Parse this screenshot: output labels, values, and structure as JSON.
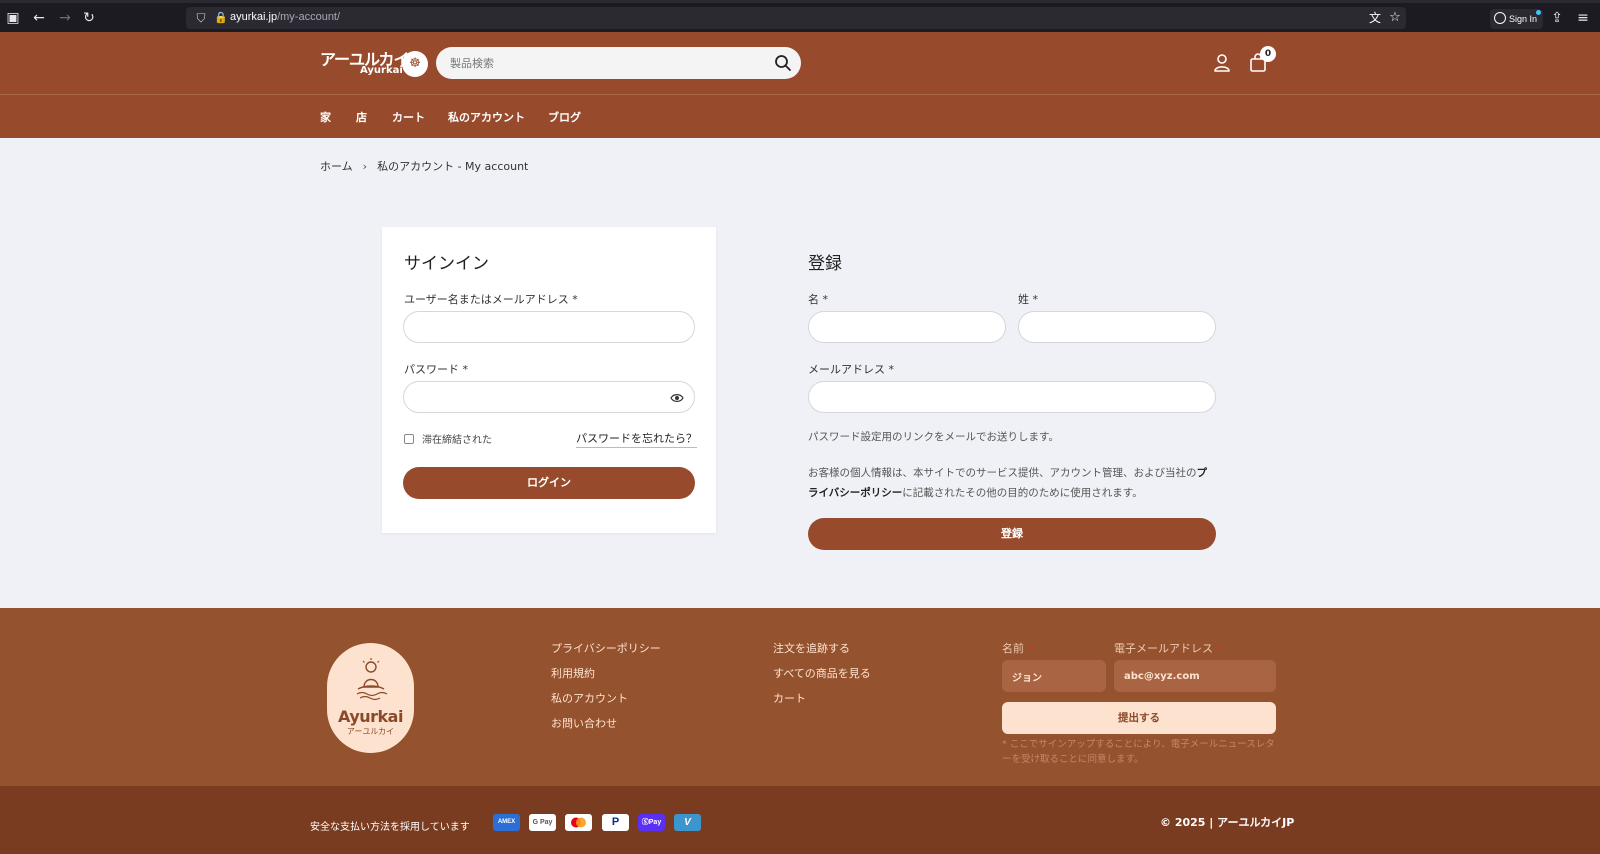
{
  "browser": {
    "url_host": "ayurkai.jp",
    "url_path": "/my-account/",
    "signin_label": "Sign In"
  },
  "header": {
    "logo_jp": "アーユルカイ",
    "logo_en": "Ayurkai",
    "search_placeholder": "製品検索",
    "cart_count": "0"
  },
  "nav": {
    "items": [
      "家",
      "店",
      "カート",
      "私のアカウント",
      "ブログ"
    ]
  },
  "breadcrumb": {
    "home": "ホーム",
    "sep": "›",
    "current": "私のアカウント - My account"
  },
  "signin": {
    "title": "サインイン",
    "username_label": "ユーザー名またはメールアドレス *",
    "password_label": "パスワード *",
    "remember_label": "滞在締結された",
    "forgot_label": "パスワードを忘れたら？",
    "login_button": "ログイン"
  },
  "register": {
    "title": "登録",
    "first_name_label": "名 *",
    "last_name_label": "姓 *",
    "email_label": "メールアドレス *",
    "password_note": "パスワード設定用のリンクをメールでお送りします。",
    "privacy_note_1": "お客様の個人情報は、本サイトでのサービス提供、アカウント管理、および当社の",
    "privacy_link_1": "プ",
    "privacy_link_2": "ライバシーポリシー",
    "privacy_note_2": "に記載されたその他の目的のために使用されます。",
    "register_button": "登録"
  },
  "footer": {
    "logo_en": "Ayurkai",
    "logo_jp": "アーユルカイ",
    "col1": [
      "プライバシーポリシー",
      "利用規約",
      "私のアカウント",
      "お問い合わせ"
    ],
    "col2": [
      "注文を追跡する",
      "すべての商品を見る",
      "カート"
    ],
    "name_label": "名前",
    "email_label": "電子メールアドレス",
    "required_mark": "*",
    "name_value": "ジョン",
    "email_value": "abc@xyz.com",
    "submit_label": "提出する",
    "disclaimer": "* ここでサインアップすることにより、電子メールニュースレターを受け取ることに同意します。",
    "secure_text": "安全な支払い方法を採用しています",
    "payments": [
      "AMEX",
      "G Pay",
      "Mastercard",
      "PayPal",
      "Shop Pay",
      "Venmo"
    ],
    "copyright": "© 2025 | アーユルカイJP"
  },
  "colors": {
    "brand": "#984b2c",
    "footer": "#95522f",
    "footer_bottom": "#7a3c21",
    "page_bg": "#f0f1f6"
  }
}
